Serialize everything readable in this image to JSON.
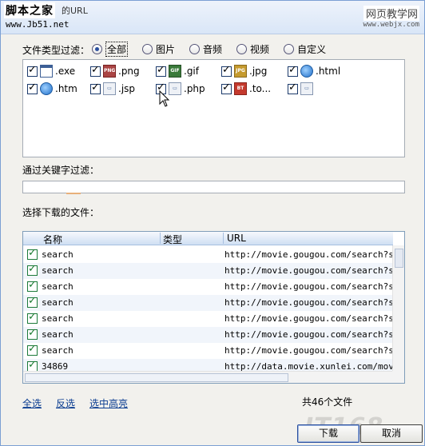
{
  "header": {
    "site_logo": "脚本之家",
    "title_rest": "的URL",
    "site_url": "www.Jb51.net",
    "watermark_cn": "网页教学网",
    "watermark_url": "www.webjx.com"
  },
  "type_filter": {
    "label": "文件类型过滤：",
    "options": [
      {
        "label": "全部",
        "selected": true
      },
      {
        "label": "图片",
        "selected": false
      },
      {
        "label": "音频",
        "selected": false
      },
      {
        "label": "视频",
        "selected": false
      },
      {
        "label": "自定义",
        "selected": false
      }
    ],
    "types": [
      {
        "label": ".exe",
        "icon": "exe-icon",
        "checked": true
      },
      {
        "label": ".png",
        "icon": "png-icon",
        "checked": true
      },
      {
        "label": ".gif",
        "icon": "gif-icon",
        "checked": true
      },
      {
        "label": ".jpg",
        "icon": "jpg-icon",
        "checked": true
      },
      {
        "label": ".html",
        "icon": "ie-icon",
        "checked": true
      },
      {
        "label": ".htm",
        "icon": "ie-icon",
        "checked": true
      },
      {
        "label": ".jsp",
        "icon": "generic-file-icon",
        "checked": true
      },
      {
        "label": ".php",
        "icon": "generic-file-icon",
        "checked": true
      },
      {
        "label": ".to...",
        "icon": "torrent-icon",
        "checked": true
      },
      {
        "label": "",
        "icon": "generic-file-icon",
        "checked": true
      }
    ]
  },
  "keyword_filter": {
    "label": "通过关键字过滤：",
    "value": ""
  },
  "file_select": {
    "label": "选择下载的文件：",
    "columns": [
      "名称",
      "类型",
      "URL"
    ],
    "rows": [
      {
        "name": "search",
        "type": "",
        "url": "http://movie.gougou.com/search?sear",
        "checked": true
      },
      {
        "name": "search",
        "type": "",
        "url": "http://movie.gougou.com/search?sear",
        "checked": true
      },
      {
        "name": "search",
        "type": "",
        "url": "http://movie.gougou.com/search?sear",
        "checked": true
      },
      {
        "name": "search",
        "type": "",
        "url": "http://movie.gougou.com/search?sear",
        "checked": true
      },
      {
        "name": "search",
        "type": "",
        "url": "http://movie.gougou.com/search?sear",
        "checked": true
      },
      {
        "name": "search",
        "type": "",
        "url": "http://movie.gougou.com/search?sear",
        "checked": true
      },
      {
        "name": "search",
        "type": "",
        "url": "http://movie.gougou.com/search?sear",
        "checked": true
      },
      {
        "name": "34869",
        "type": "",
        "url": "http://data.movie.xunlei.com/movie/",
        "checked": true
      }
    ]
  },
  "footer": {
    "select_all": "全选",
    "invert": "反选",
    "highlight": "选中高亮",
    "count": "共46个文件",
    "watermark": "IT168",
    "download": "下载",
    "cancel": "取消"
  }
}
